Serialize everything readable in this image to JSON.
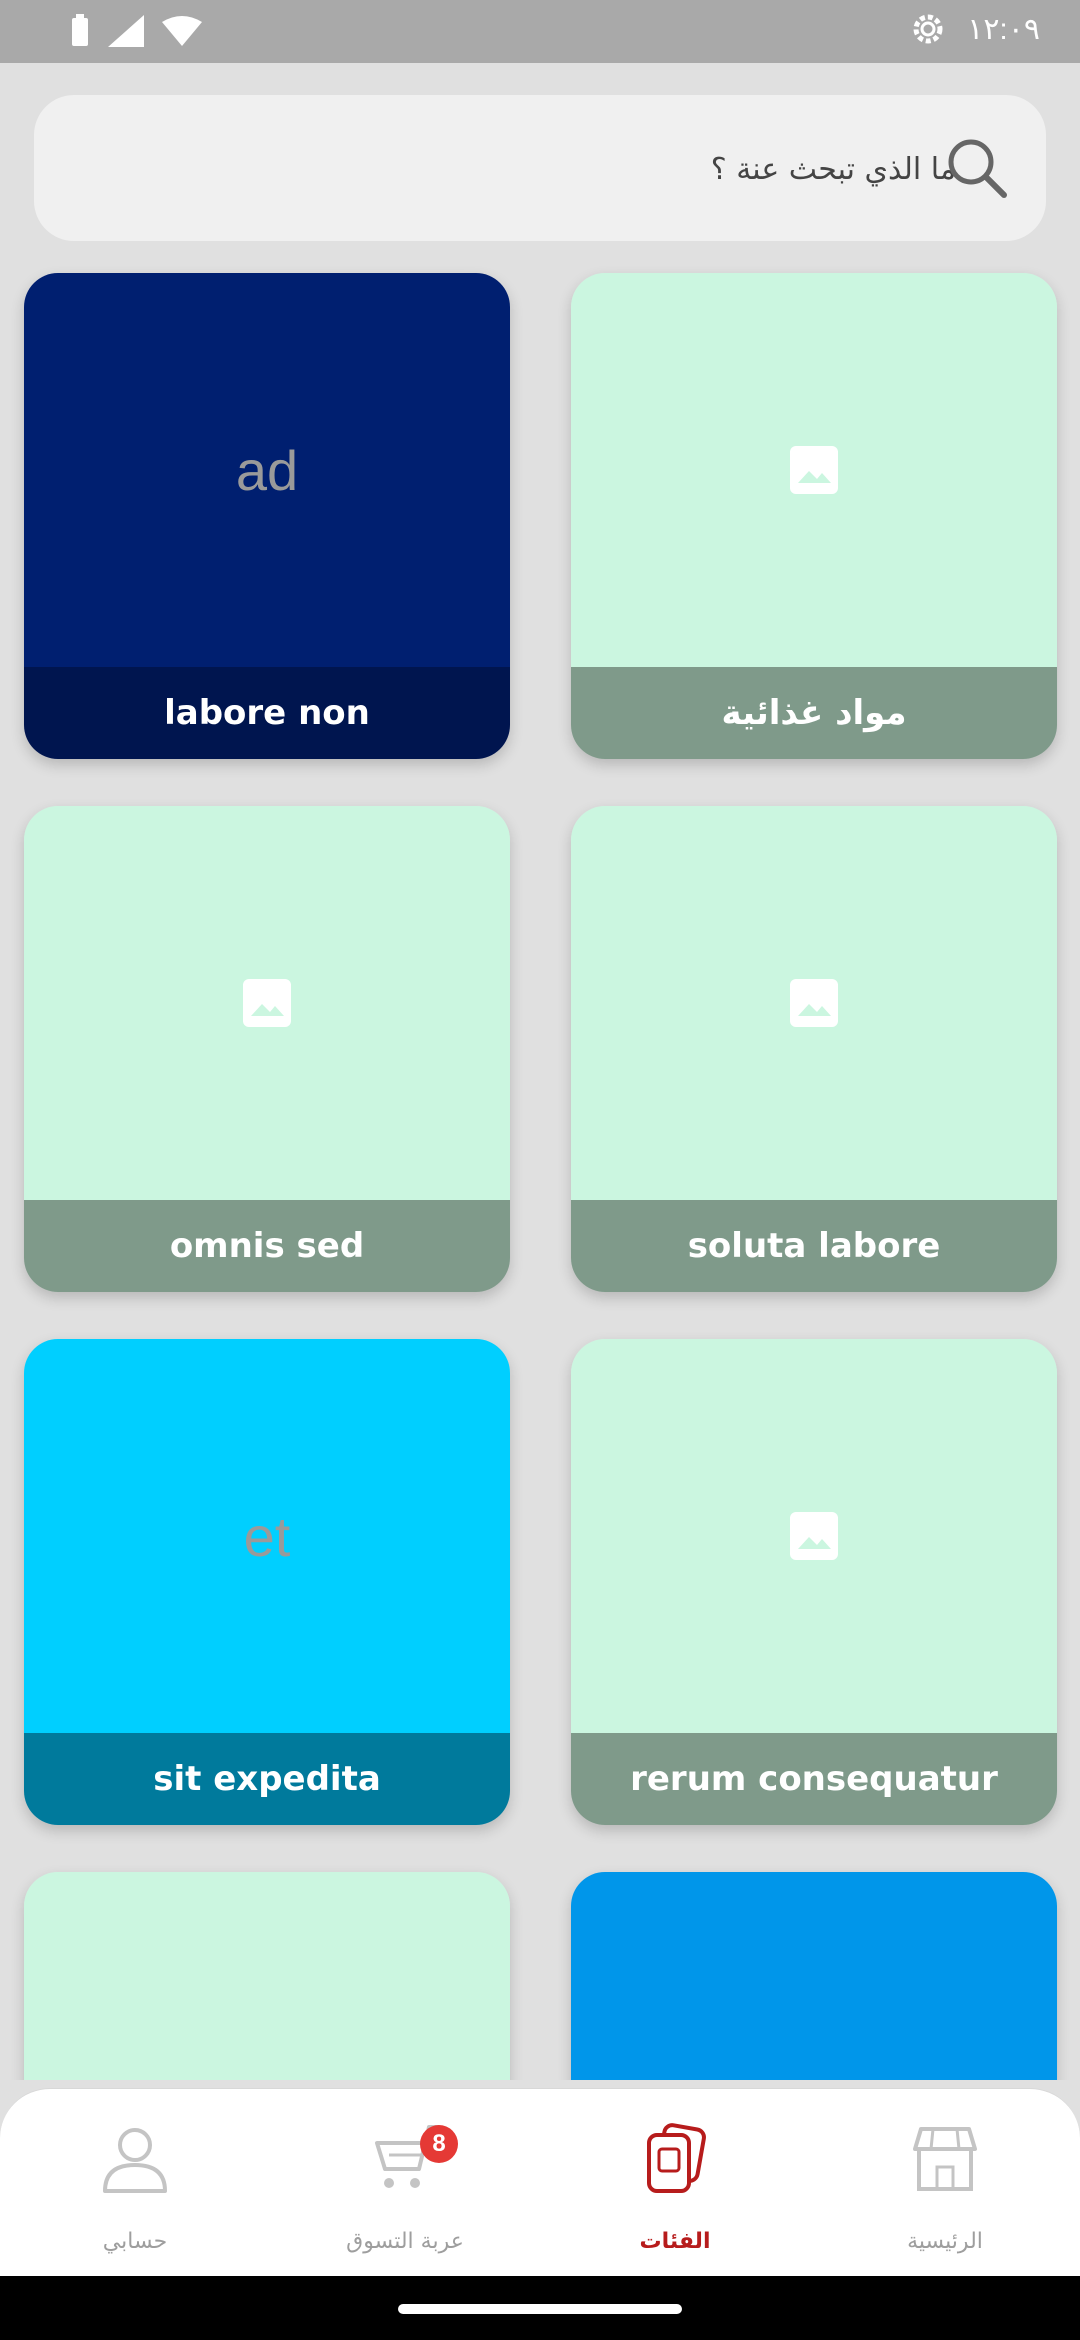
{
  "status_bar": {
    "time": "١٢:٠٩"
  },
  "search": {
    "placeholder": "ما الذي تبحث عنة ؟"
  },
  "categories": [
    {
      "caption": "labore non",
      "placeholder_text": "ad",
      "thumb_color": "#001f70",
      "caption_color": "#00154f"
    },
    {
      "caption": "مواد غذائية",
      "placeholder_text": "",
      "thumb_color": "#cbf6e0",
      "caption_color": "#7f9a8a"
    },
    {
      "caption": "omnis sed",
      "placeholder_text": "",
      "thumb_color": "#cbf6e0",
      "caption_color": "#7f9a8a"
    },
    {
      "caption": "soluta labore",
      "placeholder_text": "",
      "thumb_color": "#cbf6e0",
      "caption_color": "#7f9a8a"
    },
    {
      "caption": "sit expedita",
      "placeholder_text": "et",
      "thumb_color": "#00cfff",
      "caption_color": "#007a9c"
    },
    {
      "caption": "rerum consequatur",
      "placeholder_text": "",
      "thumb_color": "#cbf6e0",
      "caption_color": "#7f9a8a"
    },
    {
      "caption": "",
      "placeholder_text": "",
      "thumb_color": "#cbf6e0",
      "caption_color": "#7f9a8a"
    },
    {
      "caption": "",
      "placeholder_text": "",
      "thumb_color": "#0096ea",
      "caption_color": "#0096ea"
    }
  ],
  "bottom_nav": {
    "items": [
      {
        "label": "حسابي",
        "icon": "person-icon",
        "active": false
      },
      {
        "label": "عربة التسوق",
        "icon": "cart-icon",
        "active": false,
        "badge": "8"
      },
      {
        "label": "الفئات",
        "icon": "categories-icon",
        "active": true
      },
      {
        "label": "الرئيسية",
        "icon": "store-icon",
        "active": false
      }
    ]
  },
  "colors": {
    "accent": "#b71c1c",
    "badge": "#e53935",
    "inactive": "#9e9e9e"
  }
}
